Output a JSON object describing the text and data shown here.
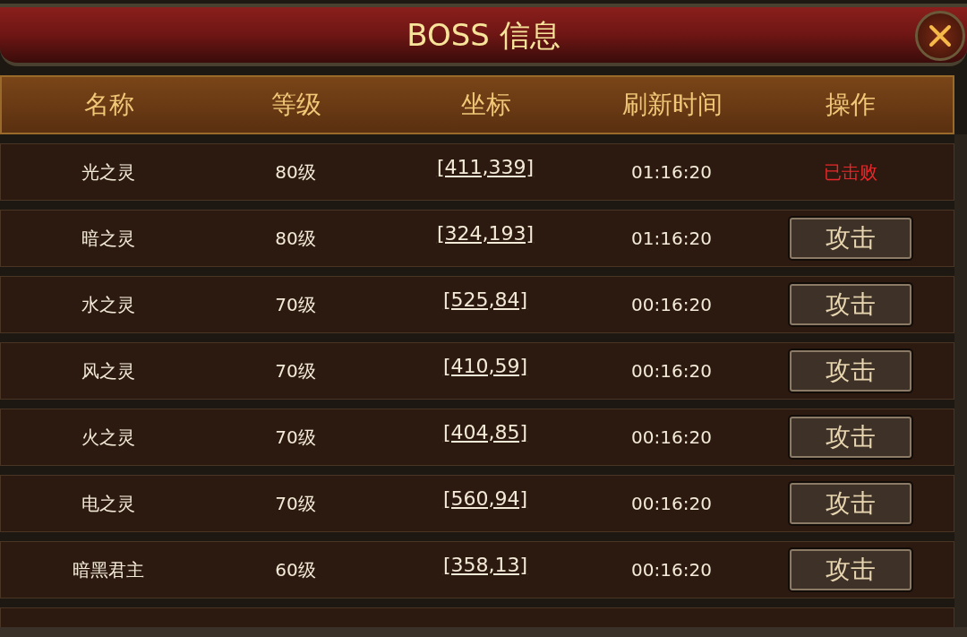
{
  "window": {
    "title": "BOSS 信息"
  },
  "table": {
    "columns": [
      "名称",
      "等级",
      "坐标",
      "刷新时间",
      "操作"
    ],
    "rows": [
      {
        "name": "光之灵",
        "level": "80级",
        "coords": "[411,339]",
        "refresh": "01:16:20",
        "action": {
          "kind": "status",
          "text": "已击败"
        }
      },
      {
        "name": "暗之灵",
        "level": "80级",
        "coords": "[324,193]",
        "refresh": "01:16:20",
        "action": {
          "kind": "button",
          "text": "攻击"
        }
      },
      {
        "name": "水之灵",
        "level": "70级",
        "coords": "[525,84]",
        "refresh": "00:16:20",
        "action": {
          "kind": "button",
          "text": "攻击"
        }
      },
      {
        "name": "风之灵",
        "level": "70级",
        "coords": "[410,59]",
        "refresh": "00:16:20",
        "action": {
          "kind": "button",
          "text": "攻击"
        }
      },
      {
        "name": "火之灵",
        "level": "70级",
        "coords": "[404,85]",
        "refresh": "00:16:20",
        "action": {
          "kind": "button",
          "text": "攻击"
        }
      },
      {
        "name": "电之灵",
        "level": "70级",
        "coords": "[560,94]",
        "refresh": "00:16:20",
        "action": {
          "kind": "button",
          "text": "攻击"
        }
      },
      {
        "name": "暗黑君主",
        "level": "60级",
        "coords": "[358,13]",
        "refresh": "00:16:20",
        "action": {
          "kind": "button",
          "text": "攻击"
        }
      }
    ]
  }
}
